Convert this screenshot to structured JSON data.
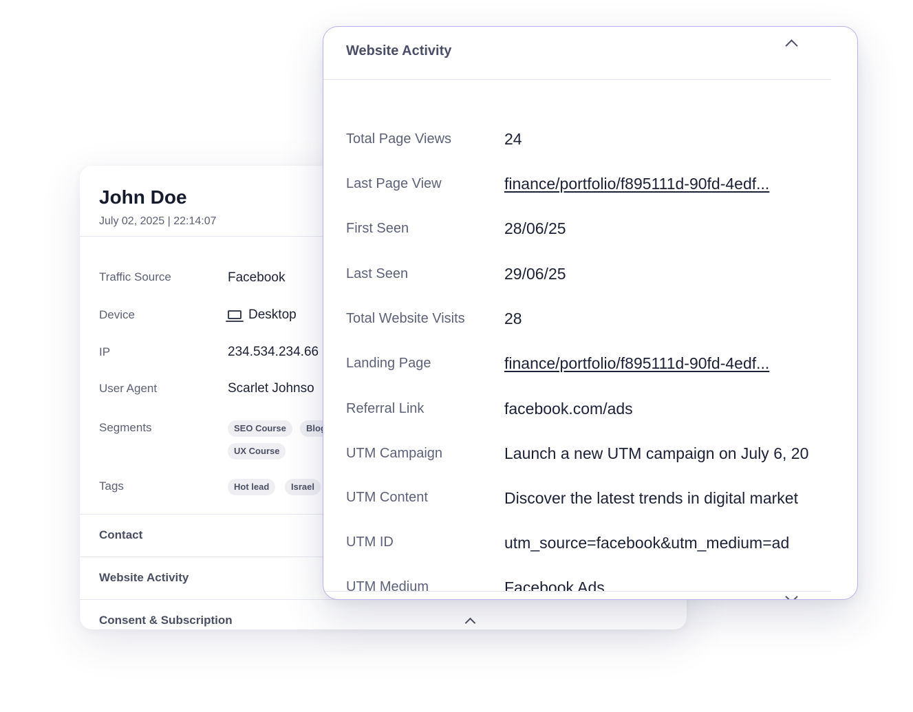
{
  "profile": {
    "name": "John Doe",
    "datetime": "July 02, 2025 | 22:14:07",
    "rows": {
      "traffic_source_label": "Traffic Source",
      "traffic_source_value": "Facebook",
      "device_label": "Device",
      "device_value": "Desktop",
      "ip_label": "IP",
      "ip_value": "234.534.234.66",
      "user_agent_label": "User Agent",
      "user_agent_value": "Scarlet Johnso",
      "segments_label": "Segments",
      "tags_label": "Tags"
    },
    "segments": [
      "SEO Course",
      "Blog",
      "UX Course"
    ],
    "tags": [
      "Hot lead",
      "Israel"
    ],
    "sections": {
      "contact": "Contact",
      "website_activity": "Website Activity",
      "consent": "Consent & Subscription"
    }
  },
  "website_activity": {
    "title": "Website Activity",
    "fields": [
      {
        "label": "Total Page Views",
        "value": "24"
      },
      {
        "label": "Last Page View",
        "value": "finance/portfolio/f895111d-90fd-4edf..."
      },
      {
        "label": "First Seen",
        "value": "28/06/25"
      },
      {
        "label": "Last Seen",
        "value": "29/06/25"
      },
      {
        "label": "Total Website Visits",
        "value": "28"
      },
      {
        "label": "Landing Page",
        "value": "finance/portfolio/f895111d-90fd-4edf..."
      },
      {
        "label": "Referral Link",
        "value": "facebook.com/ads"
      },
      {
        "label": "UTM Campaign",
        "value": "Launch a new UTM campaign on July 6, 20"
      },
      {
        "label": "UTM Content",
        "value": "Discover the latest trends in digital market"
      },
      {
        "label": "UTM ID",
        "value": "utm_source=facebook&utm_medium=ad"
      },
      {
        "label": "UTM Medium",
        "value": "Facebook Ads"
      }
    ]
  },
  "icons": {
    "device": "laptop-icon",
    "collapse": "chevron-up-icon",
    "expand": "chevron-down-icon"
  }
}
